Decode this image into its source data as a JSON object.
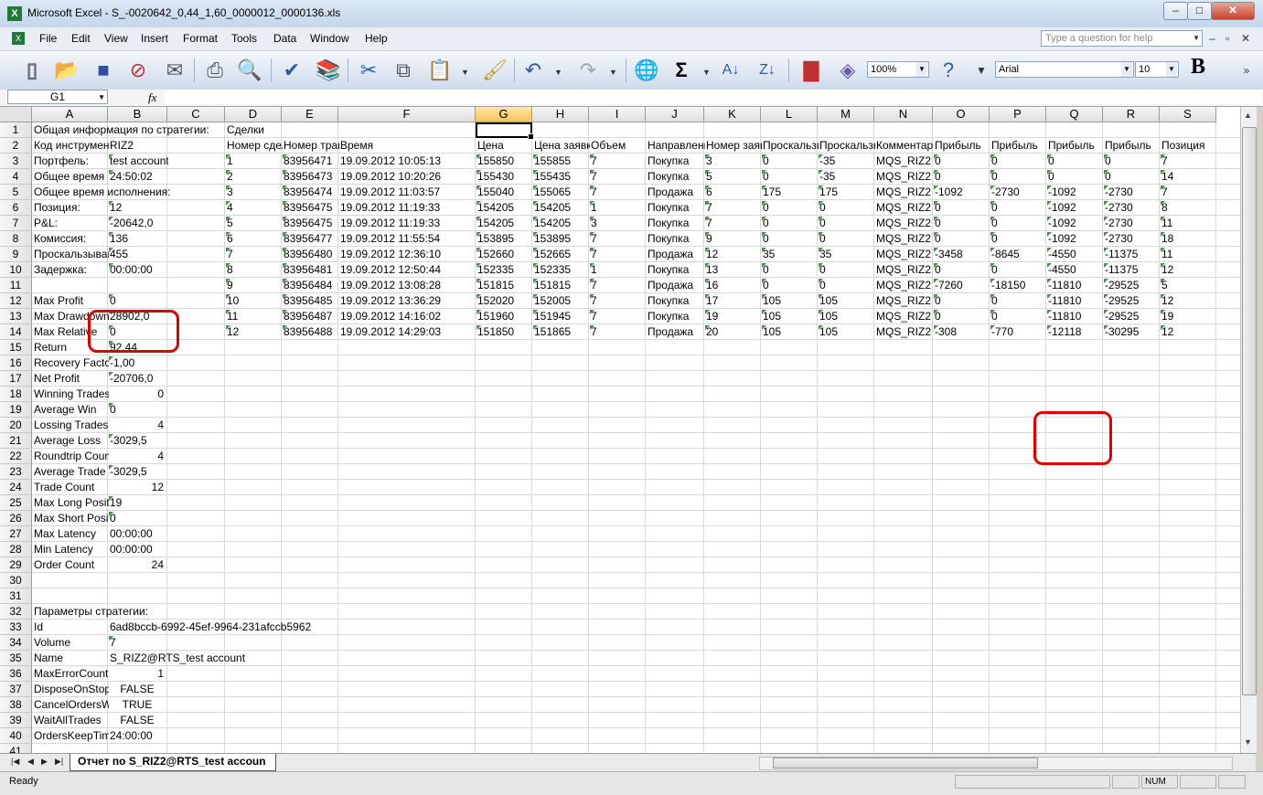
{
  "window": {
    "title": "Microsoft Excel - S_-0020642_0,44_1,60_0000012_0000136.xls",
    "app_icon": "excel-icon"
  },
  "menu": [
    "File",
    "Edit",
    "View",
    "Insert",
    "Format",
    "Tools",
    "Data",
    "Window",
    "Help"
  ],
  "ask_box": {
    "placeholder": "Type a question for help"
  },
  "toolbar": {
    "zoom": "100%",
    "font_name": "Arial",
    "font_size": "10",
    "bold_label": "B",
    "sigma": "Σ"
  },
  "formula_bar": {
    "name_box": "G1",
    "fx_label": "fx",
    "value": ""
  },
  "columns": [
    "A",
    "B",
    "C",
    "D",
    "E",
    "F",
    "G",
    "H",
    "I",
    "J",
    "K",
    "L",
    "M",
    "N",
    "O",
    "P",
    "Q",
    "R",
    "S"
  ],
  "selected_cell": "G1",
  "rows": {
    "1": {
      "A": "Общая информация по стратегии:",
      "D": "Сделки"
    },
    "2": {
      "A": "Код инструмента:",
      "B": "RIZ2",
      "D": "Номер сделки",
      "E": "Номер транзакции",
      "F": "Время",
      "G": "Цена",
      "H": "Цена заявки",
      "I": "Объем",
      "J": "Направление",
      "K": "Номер заявки",
      "L": "Проскальзывание",
      "M": "Проскальзывание",
      "N": "Комментарий",
      "O": "Прибыль",
      "P": "Прибыль",
      "Q": "Прибыль",
      "R": "Прибыль",
      "S": "Позиция"
    },
    "3": {
      "A": "Портфель:",
      "B": "test account",
      "D": "1",
      "E": "83956471",
      "F": "19.09.2012 10:05:13",
      "G": "155850",
      "H": "155855",
      "I": "7",
      "J": "Покупка",
      "K": "3",
      "L": "0",
      "M": "-35",
      "N": "MQS_RIZ2",
      "O": "0",
      "P": "0",
      "Q": "0",
      "R": "0",
      "S": "7"
    },
    "4": {
      "A": "Общее время",
      "B": "24:50:02",
      "D": "2",
      "E": "83956473",
      "F": "19.09.2012 10:20:26",
      "G": "155430",
      "H": "155435",
      "I": "7",
      "J": "Покупка",
      "K": "5",
      "L": "0",
      "M": "-35",
      "N": "MQS_RIZ2",
      "O": "0",
      "P": "0",
      "Q": "0",
      "R": "0",
      "S": "14"
    },
    "5": {
      "A": "Общее время исполнения:",
      "D": "3",
      "E": "83956474",
      "F": "19.09.2012 11:03:57",
      "G": "155040",
      "H": "155065",
      "I": "7",
      "J": "Продажа",
      "K": "6",
      "L": "175",
      "M": "175",
      "N": "MQS_RIZ2",
      "O": "-1092",
      "P": "-2730",
      "Q": "-1092",
      "R": "-2730",
      "S": "7"
    },
    "6": {
      "A": "Позиция:",
      "B": "12",
      "D": "4",
      "E": "83956475",
      "F": "19.09.2012 11:19:33",
      "G": "154205",
      "H": "154205",
      "I": "1",
      "J": "Покупка",
      "K": "7",
      "L": "0",
      "M": "0",
      "N": "MQS_RIZ2",
      "O": "0",
      "P": "0",
      "Q": "-1092",
      "R": "-2730",
      "S": "8"
    },
    "7": {
      "A": "P&L:",
      "B": "-20642,0",
      "D": "5",
      "E": "83956475",
      "F": "19.09.2012 11:19:33",
      "G": "154205",
      "H": "154205",
      "I": "3",
      "J": "Покупка",
      "K": "7",
      "L": "0",
      "M": "0",
      "N": "MQS_RIZ2",
      "O": "0",
      "P": "0",
      "Q": "-1092",
      "R": "-2730",
      "S": "11"
    },
    "8": {
      "A": "Комиссия:",
      "B": "136",
      "D": "6",
      "E": "83956477",
      "F": "19.09.2012 11:55:54",
      "G": "153895",
      "H": "153895",
      "I": "7",
      "J": "Покупка",
      "K": "9",
      "L": "0",
      "M": "0",
      "N": "MQS_RIZ2",
      "O": "0",
      "P": "0",
      "Q": "-1092",
      "R": "-2730",
      "S": "18"
    },
    "9": {
      "A": "Проскальзывание:",
      "B": "455",
      "D": "7",
      "E": "83956480",
      "F": "19.09.2012 12:36:10",
      "G": "152660",
      "H": "152665",
      "I": "7",
      "J": "Продажа",
      "K": "12",
      "L": "35",
      "M": "35",
      "N": "MQS_RIZ2",
      "O": "-3458",
      "P": "-8645",
      "Q": "-4550",
      "R": "-11375",
      "S": "11"
    },
    "10": {
      "A": "Задержка:",
      "B": "00:00:00",
      "D": "8",
      "E": "83956481",
      "F": "19.09.2012 12:50:44",
      "G": "152335",
      "H": "152335",
      "I": "1",
      "J": "Покупка",
      "K": "13",
      "L": "0",
      "M": "0",
      "N": "MQS_RIZ2",
      "O": "0",
      "P": "0",
      "Q": "-4550",
      "R": "-11375",
      "S": "12"
    },
    "11": {
      "D": "9",
      "E": "83956484",
      "F": "19.09.2012 13:08:28",
      "G": "151815",
      "H": "151815",
      "I": "7",
      "J": "Продажа",
      "K": "16",
      "L": "0",
      "M": "0",
      "N": "MQS_RIZ2",
      "O": "-7260",
      "P": "-18150",
      "Q": "-11810",
      "R": "-29525",
      "S": "5"
    },
    "12": {
      "A": "Max Profit",
      "B": "0",
      "D": "10",
      "E": "83956485",
      "F": "19.09.2012 13:36:29",
      "G": "152020",
      "H": "152005",
      "I": "7",
      "J": "Покупка",
      "K": "17",
      "L": "105",
      "M": "105",
      "N": "MQS_RIZ2",
      "O": "0",
      "P": "0",
      "Q": "-11810",
      "R": "-29525",
      "S": "12"
    },
    "13": {
      "A": "Max Drawdown",
      "B": "28902,0",
      "D": "11",
      "E": "83956487",
      "F": "19.09.2012 14:16:02",
      "G": "151960",
      "H": "151945",
      "I": "7",
      "J": "Покупка",
      "K": "19",
      "L": "105",
      "M": "105",
      "N": "MQS_RIZ2",
      "O": "0",
      "P": "0",
      "Q": "-11810",
      "R": "-29525",
      "S": "19"
    },
    "14": {
      "A": "Max Relative",
      "B": "0",
      "D": "12",
      "E": "83956488",
      "F": "19.09.2012 14:29:03",
      "G": "151850",
      "H": "151865",
      "I": "7",
      "J": "Продажа",
      "K": "20",
      "L": "105",
      "M": "105",
      "N": "MQS_RIZ2",
      "O": "-308",
      "P": "-770",
      "Q": "-12118",
      "R": "-30295",
      "S": "12"
    },
    "15": {
      "A": "Return",
      "B": "92,44"
    },
    "16": {
      "A": "Recovery Factor",
      "B": "-1,00"
    },
    "17": {
      "A": "Net Profit",
      "B": "-20706,0"
    },
    "18": {
      "A": "Winning Trades",
      "B": "0"
    },
    "19": {
      "A": "Average Win",
      "B": "0"
    },
    "20": {
      "A": "Lossing Trades",
      "B": "4"
    },
    "21": {
      "A": "Average Loss",
      "B": "-3029,5"
    },
    "22": {
      "A": "Roundtrip Count",
      "B": "4"
    },
    "23": {
      "A": "Average Trade",
      "B": "-3029,5"
    },
    "24": {
      "A": "Trade Count",
      "B": "12"
    },
    "25": {
      "A": "Max Long Position",
      "B": "19"
    },
    "26": {
      "A": "Max Short Position",
      "B": "0"
    },
    "27": {
      "A": "Max Latency",
      "B": "00:00:00"
    },
    "28": {
      "A": "Min Latency",
      "B": "00:00:00"
    },
    "29": {
      "A": "Order Count",
      "B": "24"
    },
    "32": {
      "A": "Параметры стратегии:"
    },
    "33": {
      "A": "Id",
      "B": "6ad8bccb-6992-45ef-9964-231afccb5962"
    },
    "34": {
      "A": "Volume",
      "B": "7"
    },
    "35": {
      "A": "Name",
      "B": "S_RIZ2@RTS_test account"
    },
    "36": {
      "A": "MaxErrorCount",
      "B": "1"
    },
    "37": {
      "A": "DisposeOnStop",
      "B": "FALSE"
    },
    "38": {
      "A": "CancelOrdersWhenStopping",
      "B": "TRUE"
    },
    "39": {
      "A": "WaitAllTrades",
      "B": "FALSE"
    },
    "40": {
      "A": "OrdersKeepTime",
      "B": "24:00:00"
    }
  },
  "sheet_tab": "Отчет по S_RIZ2@RTS_test accoun",
  "status": {
    "left": "Ready",
    "num": "NUM"
  },
  "colors": {
    "highlight": "#e00000",
    "selection_header": "#f5c45b",
    "error_triangle": "#3f9a3f"
  }
}
